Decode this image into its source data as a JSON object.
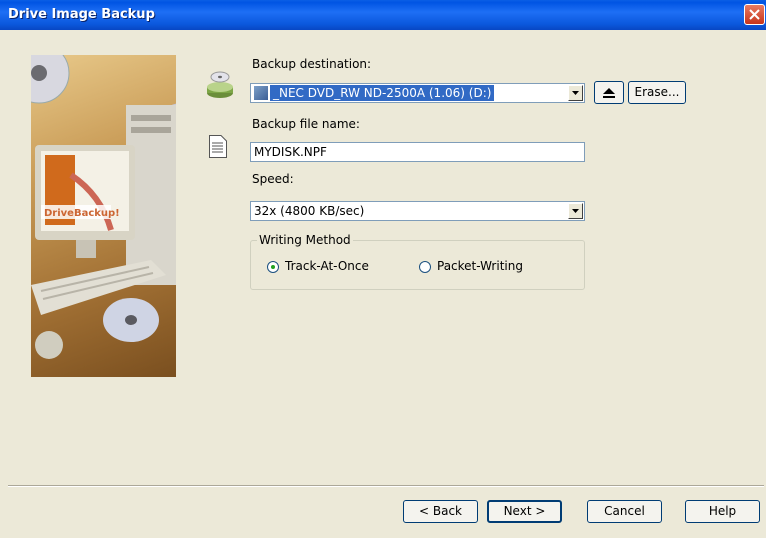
{
  "window": {
    "title": "Drive Image Backup"
  },
  "side_image": {
    "brand": "DriveBackup!"
  },
  "destination": {
    "label": "Backup destination:",
    "selected": "_NEC DVD_RW ND-2500A (1.06) (D:)",
    "erase_label": "Erase..."
  },
  "file": {
    "label": "Backup file name:",
    "value": "MYDISK.NPF"
  },
  "speed": {
    "label": "Speed:",
    "selected": "32x (4800 KB/sec)"
  },
  "writing_method": {
    "legend": "Writing Method",
    "options": [
      {
        "label": "Track-At-Once",
        "selected": true
      },
      {
        "label": "Packet-Writing",
        "selected": false
      }
    ]
  },
  "buttons": {
    "back": "< Back",
    "next": "Next >",
    "cancel": "Cancel",
    "help": "Help"
  },
  "colors": {
    "titlebar": "#0054e3",
    "dialog_bg": "#ece9d8",
    "selection": "#316ac5"
  }
}
